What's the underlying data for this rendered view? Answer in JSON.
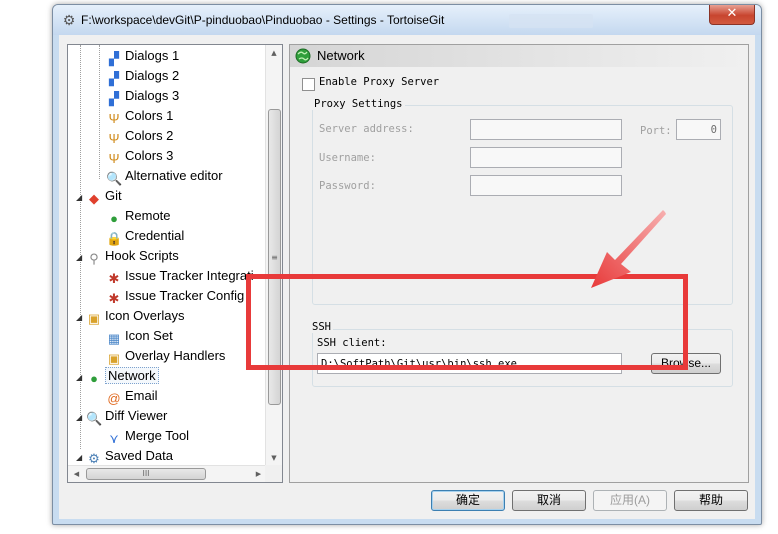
{
  "window": {
    "title": "F:\\workspace\\devGit\\P-pinduobao\\Pinduobao - Settings - TortoiseGit",
    "close_label": "✕"
  },
  "tree": {
    "items": [
      {
        "label": "Dialogs 1",
        "icon": "dialogs-icon",
        "level": 2
      },
      {
        "label": "Dialogs 2",
        "icon": "dialogs-icon",
        "level": 2
      },
      {
        "label": "Dialogs 3",
        "icon": "dialogs-icon",
        "level": 2
      },
      {
        "label": "Colors 1",
        "icon": "colors-icon",
        "level": 2
      },
      {
        "label": "Colors 2",
        "icon": "colors-icon",
        "level": 2
      },
      {
        "label": "Colors 3",
        "icon": "colors-icon",
        "level": 2
      },
      {
        "label": "Alternative editor",
        "icon": "magnifier-icon",
        "level": 2
      },
      {
        "label": "Git",
        "icon": "git-icon",
        "level": 1
      },
      {
        "label": "Remote",
        "icon": "globe-icon",
        "level": 2
      },
      {
        "label": "Credential",
        "icon": "lock-icon",
        "level": 2
      },
      {
        "label": "Hook Scripts",
        "icon": "hook-icon",
        "level": 1
      },
      {
        "label": "Issue Tracker Integrati",
        "icon": "bug-icon",
        "level": 2
      },
      {
        "label": "Issue Tracker Config",
        "icon": "bug-icon",
        "level": 2
      },
      {
        "label": "Icon Overlays",
        "icon": "overlay-icon",
        "level": 1
      },
      {
        "label": "Icon Set",
        "icon": "iconset-icon",
        "level": 2
      },
      {
        "label": "Overlay Handlers",
        "icon": "overlay-icon",
        "level": 2
      },
      {
        "label": "Network",
        "icon": "globe-icon",
        "level": 1
      },
      {
        "label": "Email",
        "icon": "email-icon",
        "level": 2
      },
      {
        "label": "Diff Viewer",
        "icon": "magnifier-icon",
        "level": 1
      },
      {
        "label": "Merge Tool",
        "icon": "merge-icon",
        "level": 2
      },
      {
        "label": "Saved Data",
        "icon": "gear-icon",
        "level": 1
      }
    ],
    "selected": "Network",
    "hscroll_grip": "III",
    "vscroll_grip": "≡"
  },
  "panel": {
    "title": "Network",
    "enable_proxy_label": "Enable Proxy Server",
    "proxy_group_label": "Proxy Settings",
    "server_address_label": "Server address:",
    "server_address_value": "",
    "port_label": "Port:",
    "port_value": "0",
    "username_label": "Username:",
    "username_value": "",
    "password_label": "Password:",
    "password_value": "",
    "ssh_group_label": "SSH",
    "ssh_client_label": "SSH client:",
    "ssh_client_value": "D:\\SoftPath\\Git\\usr\\bin\\ssh.exe",
    "browse_label": "Browse..."
  },
  "buttons": {
    "ok": "确定",
    "cancel": "取消",
    "apply": "应用(A)",
    "help": "帮助"
  },
  "colors": {
    "highlight": "#e83a3a",
    "selection_border": "#7da2ce"
  }
}
